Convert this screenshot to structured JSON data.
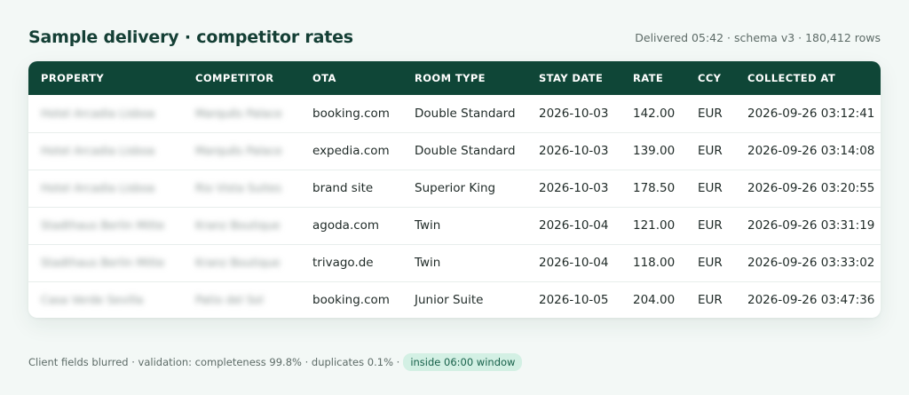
{
  "header": {
    "title": "Sample delivery · competitor rates",
    "meta": "Delivered 05:42 · schema v3 · 180,412 rows"
  },
  "table": {
    "columns": [
      "PROPERTY",
      "COMPETITOR",
      "OTA",
      "ROOM TYPE",
      "STAY DATE",
      "RATE",
      "CCY",
      "COLLECTED AT"
    ],
    "rows": [
      {
        "property": "Hotel Arcadia Lisboa",
        "competitor": "Marquês Palace",
        "ota": "booking.com",
        "room_type": "Double Standard",
        "stay_date": "2026-10-03",
        "rate": "142.00",
        "ccy": "EUR",
        "collected_at": "2026-09-26 03:12:41"
      },
      {
        "property": "Hotel Arcadia Lisboa",
        "competitor": "Marquês Palace",
        "ota": "expedia.com",
        "room_type": "Double Standard",
        "stay_date": "2026-10-03",
        "rate": "139.00",
        "ccy": "EUR",
        "collected_at": "2026-09-26 03:14:08"
      },
      {
        "property": "Hotel Arcadia Lisboa",
        "competitor": "Rio Vista Suites",
        "ota": "brand site",
        "room_type": "Superior King",
        "stay_date": "2026-10-03",
        "rate": "178.50",
        "ccy": "EUR",
        "collected_at": "2026-09-26 03:20:55"
      },
      {
        "property": "Stadthaus Berlin Mitte",
        "competitor": "Kranz Boutique",
        "ota": "agoda.com",
        "room_type": "Twin",
        "stay_date": "2026-10-04",
        "rate": "121.00",
        "ccy": "EUR",
        "collected_at": "2026-09-26 03:31:19"
      },
      {
        "property": "Stadthaus Berlin Mitte",
        "competitor": "Kranz Boutique",
        "ota": "trivago.de",
        "room_type": "Twin",
        "stay_date": "2026-10-04",
        "rate": "118.00",
        "ccy": "EUR",
        "collected_at": "2026-09-26 03:33:02"
      },
      {
        "property": "Casa Verde Sevilla",
        "competitor": "Patio del Sol",
        "ota": "booking.com",
        "room_type": "Junior Suite",
        "stay_date": "2026-10-05",
        "rate": "204.00",
        "ccy": "EUR",
        "collected_at": "2026-09-26 03:47:36"
      }
    ]
  },
  "footer": {
    "text": "Client fields blurred · validation: completeness 99.8% · duplicates 0.1% ·",
    "badge": "inside 06:00 window"
  }
}
